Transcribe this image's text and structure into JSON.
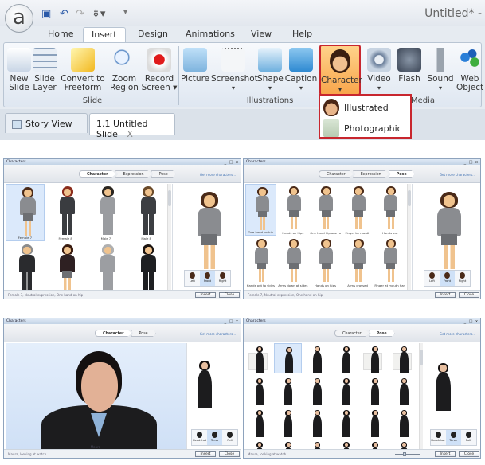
{
  "app": {
    "logo_letter": "a",
    "title": "Untitled* -",
    "tabs": [
      "Home",
      "Insert",
      "Design",
      "Animations",
      "View",
      "Help"
    ],
    "active_tab": "Insert",
    "groups": {
      "slide": {
        "label": "Slide",
        "buttons": [
          {
            "line1": "New",
            "line2": "Slide",
            "icon": "new-slide-icon"
          },
          {
            "line1": "Slide",
            "line2": "Layer",
            "icon": "slide-layer-icon"
          },
          {
            "line1": "Convert to",
            "line2": "Freeform",
            "icon": "convert-freeform-icon"
          },
          {
            "line1": "Zoom",
            "line2": "Region",
            "icon": "zoom-region-icon"
          },
          {
            "line1": "Record",
            "line2": "Screen ▾",
            "icon": "record-screen-icon"
          }
        ]
      },
      "illustrations": {
        "label": "Illustrations",
        "buttons": [
          {
            "line1": "Picture",
            "line2": "",
            "icon": "picture-icon"
          },
          {
            "line1": "Screenshot",
            "line2": "▾",
            "icon": "screenshot-icon"
          },
          {
            "line1": "Shape",
            "line2": "▾",
            "icon": "shape-icon"
          },
          {
            "line1": "Caption",
            "line2": "▾",
            "icon": "caption-icon"
          },
          {
            "line1": "Character",
            "line2": "▾",
            "icon": "character-icon"
          }
        ]
      },
      "media": {
        "label": "Media",
        "buttons": [
          {
            "line1": "Video",
            "line2": "▾",
            "icon": "video-icon"
          },
          {
            "line1": "Flash",
            "line2": "",
            "icon": "flash-icon"
          },
          {
            "line1": "Sound",
            "line2": "▾",
            "icon": "sound-icon"
          },
          {
            "line1": "Web",
            "line2": "Object",
            "icon": "web-object-icon"
          }
        ]
      }
    },
    "doc_tabs": [
      {
        "label": "Story View"
      },
      {
        "label": "1.1 Untitled Slide",
        "close": "X"
      }
    ],
    "character_menu": [
      "Illustrated",
      "Photographic"
    ],
    "highlight_color": "#c8262e"
  },
  "dialogs": [
    {
      "title": "Characters",
      "controls": "_ □ x",
      "steps": [
        "Character",
        "Expression",
        "Pose"
      ],
      "active_step": 0,
      "get_more": "Get more characters...",
      "kind": "illustrated",
      "items": [
        {
          "label": "Female 7",
          "hair": "#4a2a18",
          "suit": "#8a8c90",
          "skirt": true
        },
        {
          "label": "Female 8",
          "hair": "#8a2c1c",
          "suit": "#3a3c40",
          "skirt": false
        },
        {
          "label": "Male 7",
          "hair": "#2b2620",
          "suit": "#9a9ca0",
          "skirt": false
        },
        {
          "label": "Male 8",
          "hair": "#6a4a2a",
          "suit": "#3c3e42",
          "skirt": false
        },
        {
          "label": "",
          "hair": "#8c8c8c",
          "suit": "#2a2b2e",
          "skirt": false
        },
        {
          "label": "",
          "hair": "#3a1c10",
          "suit": "#2e2022",
          "skirt": true
        },
        {
          "label": "",
          "hair": "#b0b0b0",
          "suit": "#9c9ea2",
          "skirt": false
        },
        {
          "label": "",
          "hair": "#1c1410",
          "suit": "#1e1f22",
          "skirt": false
        }
      ],
      "selected": 0,
      "views": [
        "Left",
        "Front",
        "Right"
      ],
      "active_view": 1,
      "status": "Female 7, Neutral expression, One hand on hip",
      "insert": "Insert",
      "close": "Close"
    },
    {
      "title": "Characters",
      "controls": "_ □ x",
      "steps": [
        "Character",
        "Expression",
        "Pose"
      ],
      "active_step": 2,
      "get_more": "Get more characters...",
      "kind": "illustrated",
      "items": [
        {
          "label": "One hand on hip"
        },
        {
          "label": "Hands on hips"
        },
        {
          "label": "One hand hip one han..."
        },
        {
          "label": "Finger by mouth"
        },
        {
          "label": "Hands out"
        },
        {
          "label": "Hands out to sides"
        },
        {
          "label": "Arms down at sides"
        },
        {
          "label": "Hands on hips"
        },
        {
          "label": "Arms crossed"
        },
        {
          "label": "Finger at mouth hand o..."
        },
        {
          "label": ""
        },
        {
          "label": ""
        },
        {
          "label": ""
        },
        {
          "label": ""
        },
        {
          "label": ""
        }
      ],
      "selected": 0,
      "views": [
        "Left",
        "Front",
        "Right"
      ],
      "active_view": 1,
      "status": "Female 7, Neutral expression, One hand on hip",
      "insert": "Insert",
      "close": "Close"
    },
    {
      "title": "Characters",
      "controls": "_ □ x",
      "steps": [
        "Character",
        "Pose"
      ],
      "active_step": 0,
      "get_more": "Get more characters...",
      "kind": "photo-single",
      "main_label": "Maura",
      "views": [
        "Headshot",
        "Torso",
        "Full"
      ],
      "active_view": 1,
      "status": "Maura, looking at watch",
      "insert": "Insert",
      "close": "Close"
    },
    {
      "title": "Characters",
      "controls": "_ □ x",
      "steps": [
        "Character",
        "Pose"
      ],
      "active_step": 1,
      "get_more": "Get more characters...",
      "kind": "photo-grid",
      "item_count": 24,
      "selected": 1,
      "views": [
        "Headshot",
        "Torso",
        "Full"
      ],
      "active_view": 1,
      "status": "Maura, looking at watch",
      "insert": "Insert",
      "close": "Close"
    }
  ]
}
